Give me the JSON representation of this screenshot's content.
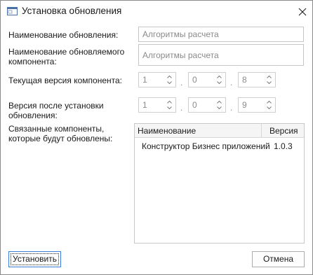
{
  "window": {
    "title": "Установка обновления",
    "icon": "window-icon",
    "close_icon": "close-icon"
  },
  "fields": {
    "update_name_label": "Наименование обновления:",
    "update_name_value": "Алгоритмы расчета",
    "component_name_label_line1": "Наименование обновляемого",
    "component_name_label_line2": "компонента:",
    "component_name_value": "Алгоритмы расчета",
    "current_version_label": "Текущая версия компонента:",
    "current_version": [
      "1",
      "0",
      "8"
    ],
    "new_version_label_line1": "Версия после установки",
    "new_version_label_line2": "обновления:",
    "new_version": [
      "1",
      "0",
      "9"
    ],
    "version_separator": ".",
    "related_label_line1": "Связанные компоненты,",
    "related_label_line2": "которые будут обновлены:"
  },
  "related_table": {
    "columns": [
      "Наименование",
      "Версия"
    ],
    "rows": [
      {
        "name": "Конструктор Бизнес приложений",
        "version": "1.0.3"
      }
    ]
  },
  "buttons": {
    "install": "Установить",
    "cancel": "Отмена"
  }
}
